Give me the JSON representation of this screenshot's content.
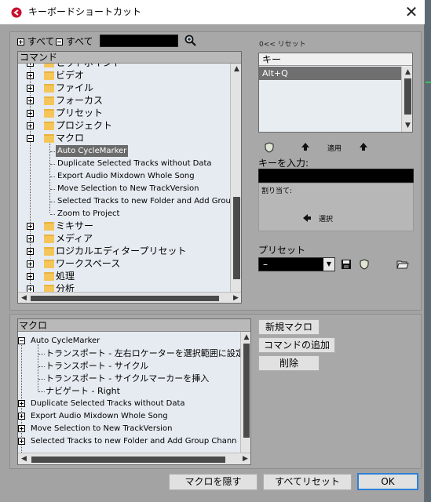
{
  "window": {
    "title": "キーボードショートカット",
    "close_symbol": "✕"
  },
  "top": {
    "expand_all": "すべて",
    "collapse_all": "すべて",
    "search_value": "",
    "reset_label": "0<< リセット"
  },
  "commands": {
    "header": "コマンド",
    "items": [
      {
        "label": "ヒットポイント",
        "kind": "folder"
      },
      {
        "label": "ビデオ",
        "kind": "folder"
      },
      {
        "label": "ファイル",
        "kind": "folder"
      },
      {
        "label": "フォーカス",
        "kind": "folder"
      },
      {
        "label": "プリセット",
        "kind": "folder"
      },
      {
        "label": "プロジェクト",
        "kind": "folder"
      },
      {
        "label": "マクロ",
        "kind": "folder-open"
      },
      {
        "label": "Auto CycleMarker",
        "kind": "leaf-selected"
      },
      {
        "label": "Duplicate Selected Tracks without Data",
        "kind": "leaf"
      },
      {
        "label": "Export Audio Mixdown Whole Song",
        "kind": "leaf"
      },
      {
        "label": "Move Selection to New TrackVersion",
        "kind": "leaf"
      },
      {
        "label": "Selected Tracks to new Folder and Add Group",
        "kind": "leaf"
      },
      {
        "label": "Zoom to Project",
        "kind": "leaf"
      },
      {
        "label": "ミキサー",
        "kind": "folder"
      },
      {
        "label": "メディア",
        "kind": "folder"
      },
      {
        "label": "ロジカルエディタープリセット",
        "kind": "folder"
      },
      {
        "label": "ワークスペース",
        "kind": "folder"
      },
      {
        "label": "処理",
        "kind": "folder"
      },
      {
        "label": "分析",
        "kind": "folder"
      }
    ]
  },
  "keys": {
    "header": "キー",
    "items": [
      "Alt+Q"
    ],
    "apply_label": "適用",
    "enter_key_label": "キーを入力:",
    "enter_key_value": "",
    "assigned_label": "割り当て:",
    "select_label": "選択"
  },
  "preset": {
    "label": "プリセット",
    "value": "–"
  },
  "macro": {
    "header": "マクロ",
    "tree": [
      {
        "label": "Auto CycleMarker",
        "level": 0,
        "kind": "open"
      },
      {
        "label": "トランスポート - 左右ロケーターを選択範囲に設定",
        "level": 1,
        "kind": "child"
      },
      {
        "label": "トランスポート - サイクル",
        "level": 1,
        "kind": "child"
      },
      {
        "label": "トランスポート - サイクルマーカーを挿入",
        "level": 1,
        "kind": "child"
      },
      {
        "label": "ナビゲート - Right",
        "level": 1,
        "kind": "child"
      },
      {
        "label": "Duplicate Selected Tracks without Data",
        "level": 0,
        "kind": "closed"
      },
      {
        "label": "Export Audio Mixdown Whole Song",
        "level": 0,
        "kind": "closed"
      },
      {
        "label": "Move Selection to New TrackVersion",
        "level": 0,
        "kind": "closed"
      },
      {
        "label": "Selected Tracks to new Folder and Add Group Chann",
        "level": 0,
        "kind": "closed"
      }
    ],
    "buttons": {
      "new_macro": "新規マクロ",
      "add_command": "コマンドの追加",
      "delete": "削除"
    }
  },
  "footer": {
    "hide_macro": "マクロを隠す",
    "reset_all": "すべてリセット",
    "ok": "OK"
  }
}
